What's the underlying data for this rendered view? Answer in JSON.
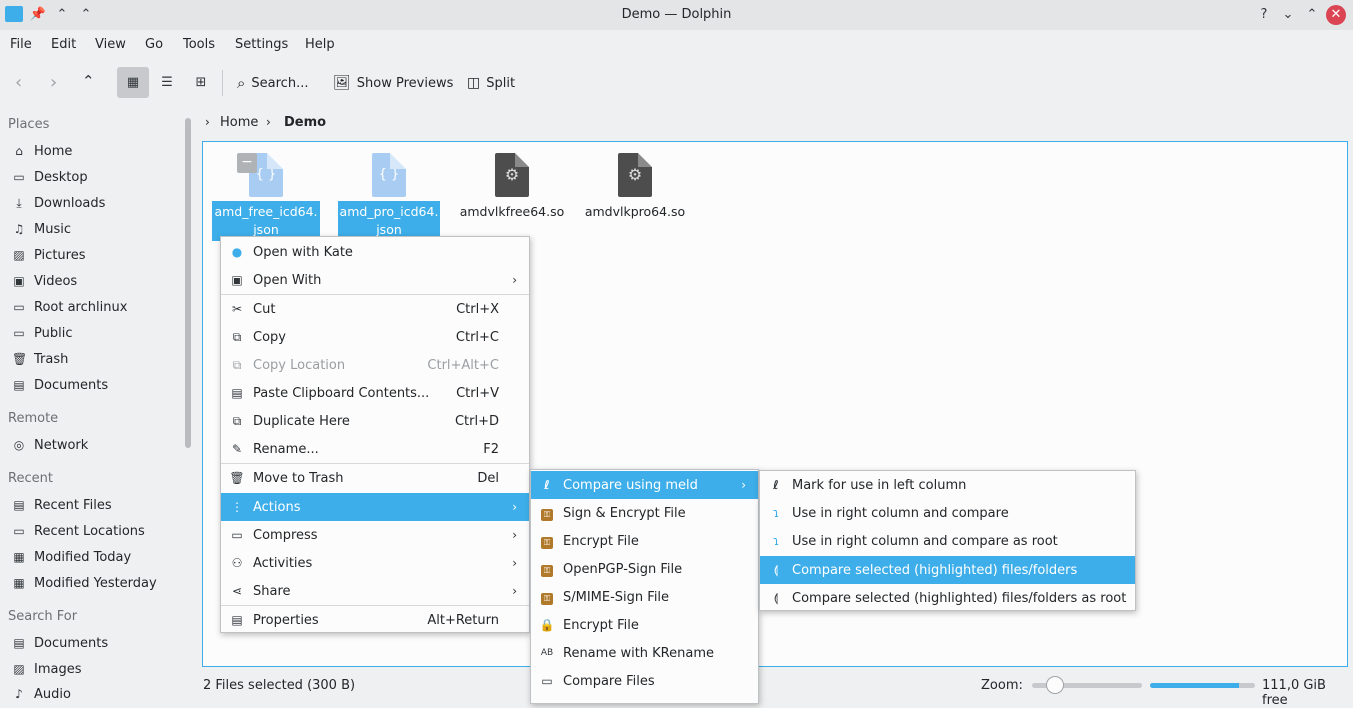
{
  "window": {
    "title": "Demo — Dolphin"
  },
  "menubar": [
    "File",
    "Edit",
    "View",
    "Go",
    "Tools",
    "Settings",
    "Help"
  ],
  "toolbar": {
    "search": "Search...",
    "previews": "Show Previews",
    "split": "Split"
  },
  "sidebar": {
    "places_header": "Places",
    "places": [
      "Home",
      "Desktop",
      "Downloads",
      "Music",
      "Pictures",
      "Videos",
      "Root archlinux",
      "Public",
      "Trash",
      "Documents"
    ],
    "remote_header": "Remote",
    "remote": [
      "Network"
    ],
    "recent_header": "Recent",
    "recent": [
      "Recent Files",
      "Recent Locations",
      "Modified Today",
      "Modified Yesterday"
    ],
    "search_header": "Search For",
    "search": [
      "Documents",
      "Images",
      "Audio"
    ]
  },
  "breadcrumb": {
    "home": "Home",
    "current": "Demo"
  },
  "files": [
    {
      "line1": "amd_free_icd64.",
      "line2": "json"
    },
    {
      "line1": "amd_pro_icd64.",
      "line2": "json"
    },
    {
      "line1": "amdvlkfree64.so"
    },
    {
      "line1": "amdvlkpro64.so"
    }
  ],
  "status": {
    "selection": "2 Files selected (300 B)",
    "zoom_label": "Zoom:",
    "free_space": "111,0 GiB free",
    "zoom_level": 0.15,
    "disk_used_fraction": 0.85
  },
  "context_menu": [
    {
      "label": "Open with Kate",
      "shortcut": ""
    },
    {
      "label": "Open With",
      "shortcut": ""
    },
    {
      "label": "Cut",
      "shortcut": "Ctrl+X"
    },
    {
      "label": "Copy",
      "shortcut": "Ctrl+C"
    },
    {
      "label": "Copy Location",
      "shortcut": "Ctrl+Alt+C"
    },
    {
      "label": "Paste Clipboard Contents...",
      "shortcut": "Ctrl+V"
    },
    {
      "label": "Duplicate Here",
      "shortcut": "Ctrl+D"
    },
    {
      "label": "Rename...",
      "shortcut": "F2"
    },
    {
      "label": "Move to Trash",
      "shortcut": "Del"
    },
    {
      "label": "Actions",
      "shortcut": ""
    },
    {
      "label": "Compress",
      "shortcut": ""
    },
    {
      "label": "Activities",
      "shortcut": ""
    },
    {
      "label": "Share",
      "shortcut": ""
    },
    {
      "label": "Properties",
      "shortcut": "Alt+Return"
    }
  ],
  "actions_menu": [
    "Compare using meld",
    "Sign & Encrypt File",
    "Encrypt File",
    "OpenPGP-Sign File",
    "S/MIME-Sign File",
    "Encrypt File",
    "Rename with KRename",
    "Compare Files"
  ],
  "meld_menu": [
    "Mark for use in left column",
    "Use in right column and compare",
    "Use in right column and compare as root",
    "Compare selected (highlighted) files/folders",
    "Compare selected (highlighted) files/folders as root"
  ],
  "colors": {
    "accent": "#3daee9",
    "close": "#da4453"
  }
}
